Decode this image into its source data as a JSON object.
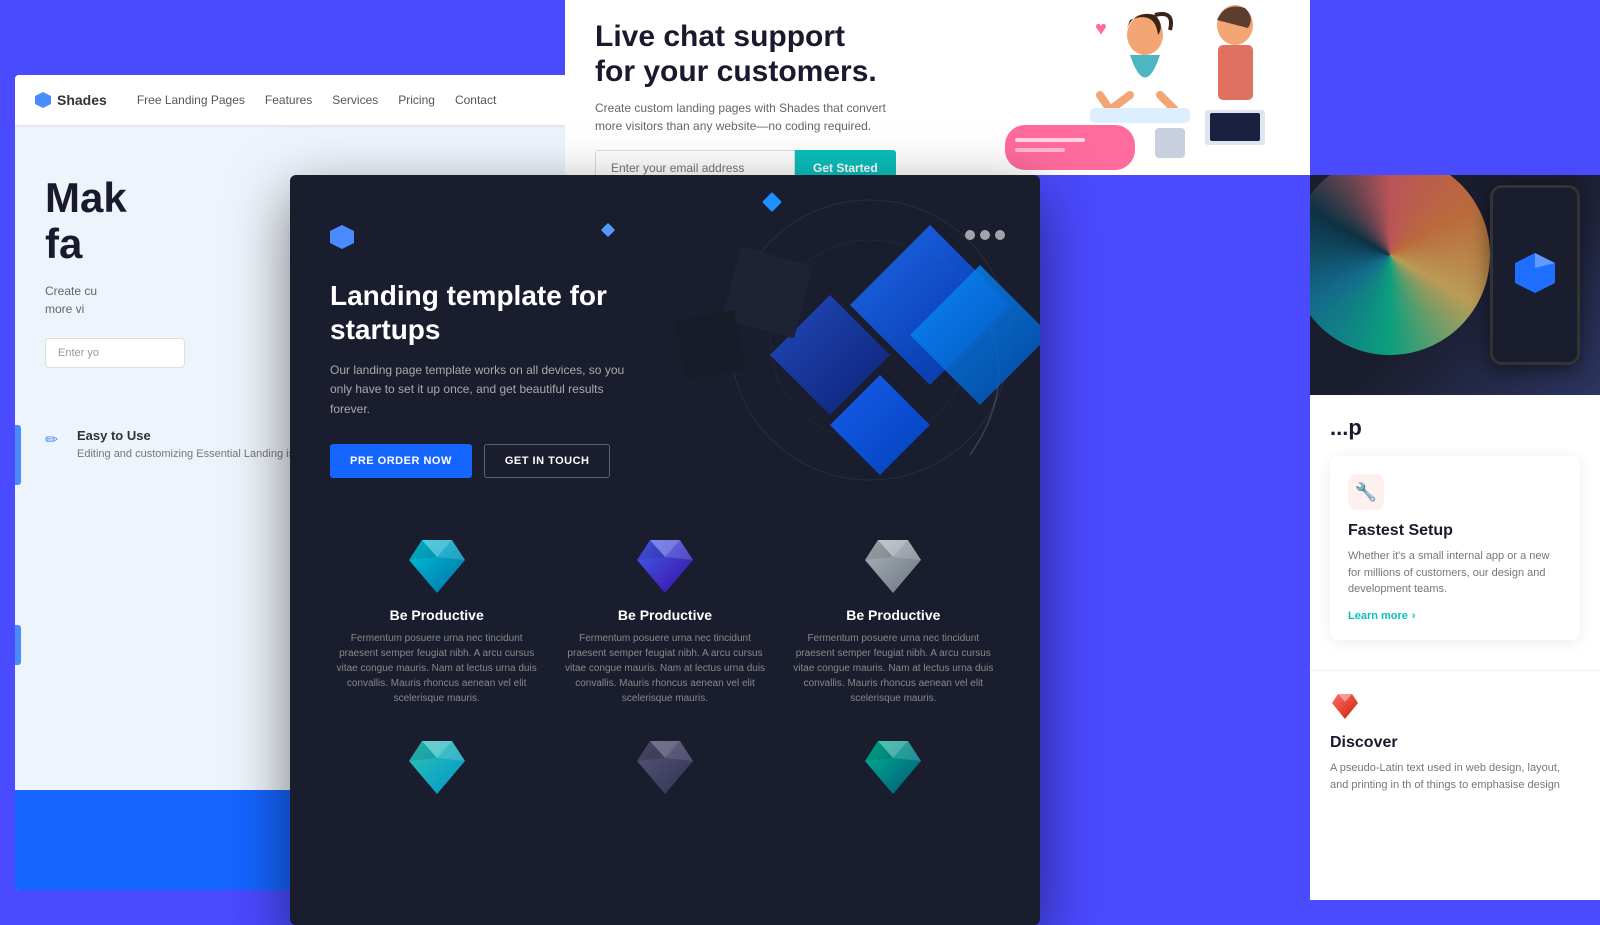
{
  "bg": {
    "color": "#4a4aff"
  },
  "left_panel": {
    "nav": {
      "logo": "Shades",
      "links": [
        "Free Landing Pages",
        "Features",
        "Services",
        "Pricing",
        "Contact"
      ]
    },
    "hero": {
      "title_partial": "Mak\nfa",
      "desc_partial": "Create cu\nmore vi",
      "email_placeholder": "Enter yo"
    },
    "features": [
      {
        "icon": "pencil",
        "title": "Easy to Use",
        "desc": "Editing and customizing Essential Landing is easy and fast."
      }
    ]
  },
  "center_panel": {
    "logo_icon": "hexagon",
    "hero": {
      "title": "Landing template for startups",
      "desc": "Our landing page template works on all devices, so you only have to set it up once, and get beautiful results forever.",
      "btn_preorder": "PRE ORDER NOW",
      "btn_getintouch": "GET IN TOUCH"
    },
    "features": [
      {
        "title": "Be Productive",
        "desc": "Fermentum posuere urna nec tincidunt praesent semper feugiat nibh. A arcu cursus vitae congue mauris. Nam at lectus urna duis convallis. Mauris rhoncus aenean vel elit scelerisque mauris.",
        "icon_type": "gem_cyan"
      },
      {
        "title": "Be Productive",
        "desc": "Fermentum posuere urna nec tincidunt praesent semper feugiat nibh. A arcu cursus vitae congue mauris. Nam at lectus urna duis convallis. Mauris rhoncus aenean vel elit scelerisque mauris.",
        "icon_type": "gem_blue"
      },
      {
        "title": "Be Productive",
        "desc": "Fermentum posuere urna nec tincidunt praesent semper feugiat nibh. A arcu cursus vitae congue mauris. Nam at lectus urna duis convallis. Mauris rhoncus aenean vel elit scelerisque mauris.",
        "icon_type": "gem_gray"
      }
    ],
    "features_bottom": [
      {
        "icon_type": "gem_cyan2"
      },
      {
        "icon_type": "gem_dark"
      },
      {
        "icon_type": "gem_teal"
      }
    ]
  },
  "top_center": {
    "title": "Live chat support\nfor your customers.",
    "desc": "Create custom landing pages with Shades that convert more visitors than any website—no coding required.",
    "email_placeholder": "Enter your email address",
    "btn_label": "Get Started"
  },
  "right_panel": {
    "partial_text": "...p",
    "card": {
      "icon": "wrench",
      "title": "Fastest Setup",
      "desc": "Whether it's a small internal app or a new for millions of customers, our design and development teams.",
      "link": "Learn more"
    }
  },
  "bottom_right": {
    "icon": "gem_red",
    "title": "Discover",
    "desc": "A pseudo-Latin text used in web design, layout, and printing in th of things to emphasise design"
  }
}
